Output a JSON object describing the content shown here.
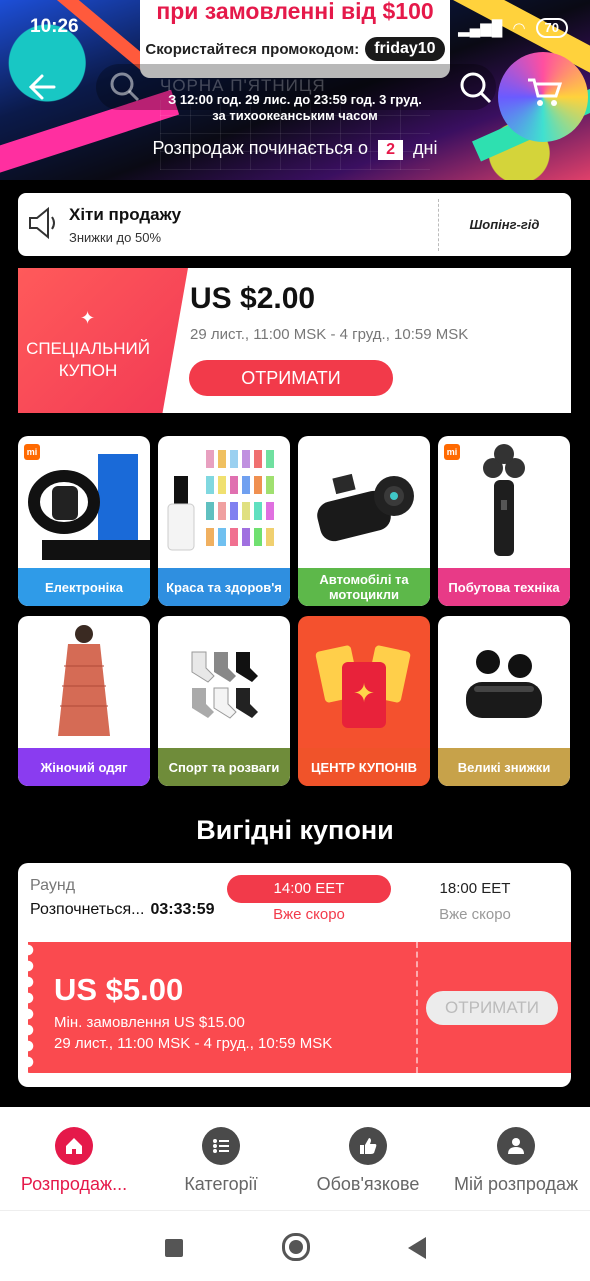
{
  "status": {
    "time": "10:26",
    "battery": "70"
  },
  "promo": {
    "headline": "при замовленні від $100",
    "code_prefix": "Скористайтеся промокодом:",
    "code": "friday10"
  },
  "hero": {
    "search_placeholder": "ЧОРНА П'ЯТНИЦЯ",
    "dates_line1": "З 12:00 год. 29 лис. до 23:59 год. 3 груд.",
    "dates_line2": "за тихоокеанським часом",
    "sale_prefix": "Розпродаж починається о",
    "days_count": "2",
    "days_suffix": "дні"
  },
  "hits": {
    "title": "Хіти продажу",
    "subtitle": "Знижки до 50%",
    "guide": "Шопінг-гід"
  },
  "coupon": {
    "label": "СПЕЦІАЛЬНИЙ КУПОН",
    "amount": "US $2.00",
    "dates": "29 лист., 11:00 MSK - 4 груд., 10:59 MSK",
    "button": "ОТРИМАТИ"
  },
  "categories": [
    {
      "label": "Електроніка",
      "color": "#2f9be8"
    },
    {
      "label": "Краса та здоров'я",
      "color": "#2f8fe0"
    },
    {
      "label": "Автомобілі та мотоцикли",
      "color": "#5db84a"
    },
    {
      "label": "Побутова техніка",
      "color": "#e83a87"
    },
    {
      "label": "Жіночий одяг",
      "color": "#8a3cf0"
    },
    {
      "label": "Спорт та розваги",
      "color": "#6f8c3a"
    },
    {
      "label": "ЦЕНТР КУПОНІВ",
      "color": "#f0532a"
    },
    {
      "label": "Великі знижки",
      "color": "#c7a24a"
    }
  ],
  "best": {
    "title": "Вигідні купони",
    "round_label": "Раунд",
    "round_start": "Розпочнеться...",
    "countdown": "03:33:59",
    "tab1_time": "14:00 EET",
    "tab1_sub": "Вже скоро",
    "tab2_time": "18:00 EET",
    "tab2_sub": "Вже скоро",
    "voucher_amount": "US $5.00",
    "voucher_min": "Мін. замовлення US $15.00",
    "voucher_dates": "29 лист., 11:00 MSK - 4 груд., 10:59 MSK",
    "voucher_button": "ОТРИМАТИ"
  },
  "nav": [
    {
      "label": "Розпродаж...",
      "icon": "home-icon"
    },
    {
      "label": "Категорії",
      "icon": "list-icon"
    },
    {
      "label": "Обов'язкове",
      "icon": "thumbs-up-icon"
    },
    {
      "label": "Мій розпродаж",
      "icon": "user-icon"
    }
  ],
  "colors": {
    "accent": "#e5194a",
    "coupon_red": "#f23a4a"
  }
}
